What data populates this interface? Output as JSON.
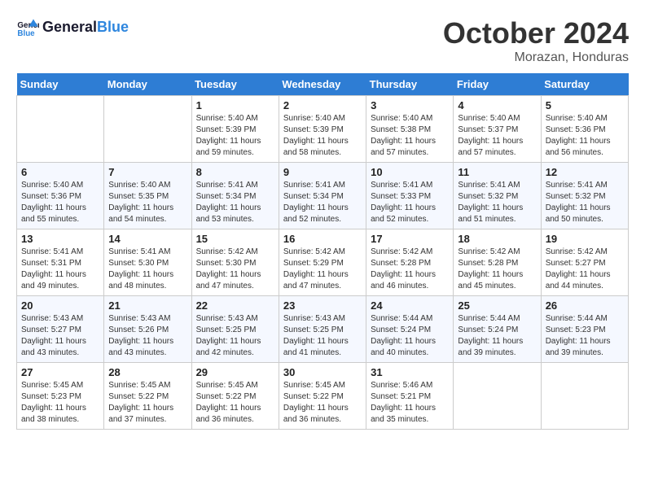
{
  "header": {
    "logo_line1": "General",
    "logo_line2": "Blue",
    "month": "October 2024",
    "location": "Morazan, Honduras"
  },
  "weekdays": [
    "Sunday",
    "Monday",
    "Tuesday",
    "Wednesday",
    "Thursday",
    "Friday",
    "Saturday"
  ],
  "weeks": [
    [
      {
        "day": "",
        "content": ""
      },
      {
        "day": "",
        "content": ""
      },
      {
        "day": "1",
        "content": "Sunrise: 5:40 AM\nSunset: 5:39 PM\nDaylight: 11 hours and 59 minutes."
      },
      {
        "day": "2",
        "content": "Sunrise: 5:40 AM\nSunset: 5:39 PM\nDaylight: 11 hours and 58 minutes."
      },
      {
        "day": "3",
        "content": "Sunrise: 5:40 AM\nSunset: 5:38 PM\nDaylight: 11 hours and 57 minutes."
      },
      {
        "day": "4",
        "content": "Sunrise: 5:40 AM\nSunset: 5:37 PM\nDaylight: 11 hours and 57 minutes."
      },
      {
        "day": "5",
        "content": "Sunrise: 5:40 AM\nSunset: 5:36 PM\nDaylight: 11 hours and 56 minutes."
      }
    ],
    [
      {
        "day": "6",
        "content": "Sunrise: 5:40 AM\nSunset: 5:36 PM\nDaylight: 11 hours and 55 minutes."
      },
      {
        "day": "7",
        "content": "Sunrise: 5:40 AM\nSunset: 5:35 PM\nDaylight: 11 hours and 54 minutes."
      },
      {
        "day": "8",
        "content": "Sunrise: 5:41 AM\nSunset: 5:34 PM\nDaylight: 11 hours and 53 minutes."
      },
      {
        "day": "9",
        "content": "Sunrise: 5:41 AM\nSunset: 5:34 PM\nDaylight: 11 hours and 52 minutes."
      },
      {
        "day": "10",
        "content": "Sunrise: 5:41 AM\nSunset: 5:33 PM\nDaylight: 11 hours and 52 minutes."
      },
      {
        "day": "11",
        "content": "Sunrise: 5:41 AM\nSunset: 5:32 PM\nDaylight: 11 hours and 51 minutes."
      },
      {
        "day": "12",
        "content": "Sunrise: 5:41 AM\nSunset: 5:32 PM\nDaylight: 11 hours and 50 minutes."
      }
    ],
    [
      {
        "day": "13",
        "content": "Sunrise: 5:41 AM\nSunset: 5:31 PM\nDaylight: 11 hours and 49 minutes."
      },
      {
        "day": "14",
        "content": "Sunrise: 5:41 AM\nSunset: 5:30 PM\nDaylight: 11 hours and 48 minutes."
      },
      {
        "day": "15",
        "content": "Sunrise: 5:42 AM\nSunset: 5:30 PM\nDaylight: 11 hours and 47 minutes."
      },
      {
        "day": "16",
        "content": "Sunrise: 5:42 AM\nSunset: 5:29 PM\nDaylight: 11 hours and 47 minutes."
      },
      {
        "day": "17",
        "content": "Sunrise: 5:42 AM\nSunset: 5:28 PM\nDaylight: 11 hours and 46 minutes."
      },
      {
        "day": "18",
        "content": "Sunrise: 5:42 AM\nSunset: 5:28 PM\nDaylight: 11 hours and 45 minutes."
      },
      {
        "day": "19",
        "content": "Sunrise: 5:42 AM\nSunset: 5:27 PM\nDaylight: 11 hours and 44 minutes."
      }
    ],
    [
      {
        "day": "20",
        "content": "Sunrise: 5:43 AM\nSunset: 5:27 PM\nDaylight: 11 hours and 43 minutes."
      },
      {
        "day": "21",
        "content": "Sunrise: 5:43 AM\nSunset: 5:26 PM\nDaylight: 11 hours and 43 minutes."
      },
      {
        "day": "22",
        "content": "Sunrise: 5:43 AM\nSunset: 5:25 PM\nDaylight: 11 hours and 42 minutes."
      },
      {
        "day": "23",
        "content": "Sunrise: 5:43 AM\nSunset: 5:25 PM\nDaylight: 11 hours and 41 minutes."
      },
      {
        "day": "24",
        "content": "Sunrise: 5:44 AM\nSunset: 5:24 PM\nDaylight: 11 hours and 40 minutes."
      },
      {
        "day": "25",
        "content": "Sunrise: 5:44 AM\nSunset: 5:24 PM\nDaylight: 11 hours and 39 minutes."
      },
      {
        "day": "26",
        "content": "Sunrise: 5:44 AM\nSunset: 5:23 PM\nDaylight: 11 hours and 39 minutes."
      }
    ],
    [
      {
        "day": "27",
        "content": "Sunrise: 5:45 AM\nSunset: 5:23 PM\nDaylight: 11 hours and 38 minutes."
      },
      {
        "day": "28",
        "content": "Sunrise: 5:45 AM\nSunset: 5:22 PM\nDaylight: 11 hours and 37 minutes."
      },
      {
        "day": "29",
        "content": "Sunrise: 5:45 AM\nSunset: 5:22 PM\nDaylight: 11 hours and 36 minutes."
      },
      {
        "day": "30",
        "content": "Sunrise: 5:45 AM\nSunset: 5:22 PM\nDaylight: 11 hours and 36 minutes."
      },
      {
        "day": "31",
        "content": "Sunrise: 5:46 AM\nSunset: 5:21 PM\nDaylight: 11 hours and 35 minutes."
      },
      {
        "day": "",
        "content": ""
      },
      {
        "day": "",
        "content": ""
      }
    ]
  ]
}
